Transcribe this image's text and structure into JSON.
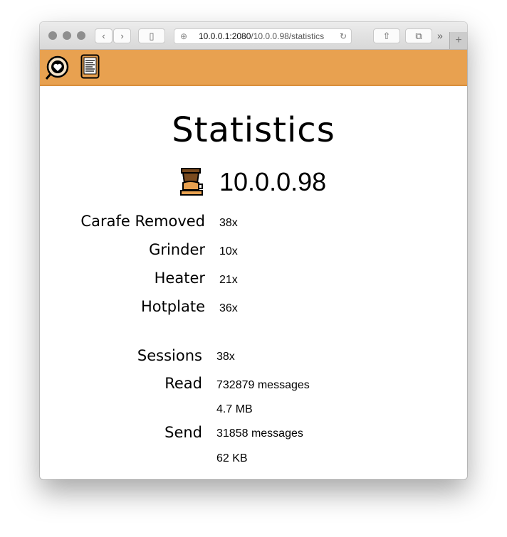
{
  "browser": {
    "url_host": "10.0.0.1:2080",
    "url_path": "/10.0.0.98/statistics",
    "back": "‹",
    "forward": "›",
    "more": "»",
    "new_tab": "+"
  },
  "page": {
    "title": "Statistics",
    "device": "10.0.0.98"
  },
  "counters": [
    {
      "label": "Carafe Removed",
      "value": "38x"
    },
    {
      "label": "Grinder",
      "value": "10x"
    },
    {
      "label": "Heater",
      "value": "21x"
    },
    {
      "label": "Hotplate",
      "value": "36x"
    }
  ],
  "network": {
    "sessions_label": "Sessions",
    "sessions": "38x",
    "read_label": "Read",
    "read_messages": "732879 messages",
    "read_size": "4.7 MB",
    "send_label": "Send",
    "send_messages": "31858 messages",
    "send_size": "62 KB"
  },
  "colors": {
    "accent": "#e8a150"
  }
}
